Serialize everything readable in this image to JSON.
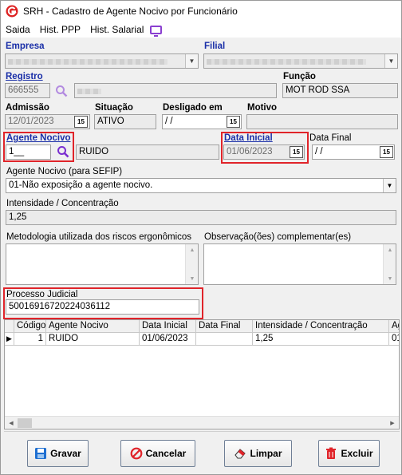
{
  "window": {
    "title": "SRH - Cadastro de Agente Nocivo por Funcionário"
  },
  "menu": {
    "items": [
      "Saida",
      "Hist. PPP",
      "Hist. Salarial"
    ]
  },
  "labels": {
    "empresa": "Empresa",
    "filial": "Filial",
    "registro": "Registro",
    "funcao": "Função",
    "admissao": "Admissão",
    "situacao": "Situação",
    "desligado_em": "Desligado em",
    "motivo": "Motivo",
    "agente_nocivo": "Agente Nocivo",
    "data_inicial": "Data Inicial",
    "data_final": "Data Final",
    "agente_sefip": "Agente Nocivo (para SEFIP)",
    "intensidade": "Intensidade /  Concentração",
    "metodologia": "Metodologia utilizada dos riscos ergonômicos",
    "observacao": "Observação(ões) complementar(es)",
    "processo": "Processo Judicial"
  },
  "values": {
    "registro": "666555",
    "funcao": "MOT ROD SSA",
    "admissao": "12/01/2023",
    "situacao": "ATIVO",
    "desligado_em": " / /",
    "agente_nocivo_codigo": "1__",
    "agente_nocivo_nome": "RUIDO",
    "data_inicial": "01/06/2023",
    "data_final": " / /",
    "agente_sefip": "01-Não exposição a agente nocivo.",
    "intensidade": "1,25",
    "processo": "50016916720224036112",
    "calendar_icon_text": "15"
  },
  "grid": {
    "columns": [
      "Código",
      "Agente Nocivo",
      "Data Inicial",
      "Data Final",
      "Intensidade /  Concentração",
      "Ag"
    ],
    "rows": [
      {
        "indicator": "▶",
        "cells": [
          "1",
          "RUIDO",
          "01/06/2023",
          "",
          "1,25",
          "01"
        ]
      }
    ]
  },
  "buttons": {
    "gravar": "Gravar",
    "cancelar": "Cancelar",
    "limpar": "Limpar",
    "excluir": "Excluir"
  },
  "colors": {
    "label_blue": "#1a2fa8",
    "highlight_red": "#e0242a",
    "menu_icon": "#8a3fd0",
    "search_icon": "#8a3fd0"
  }
}
